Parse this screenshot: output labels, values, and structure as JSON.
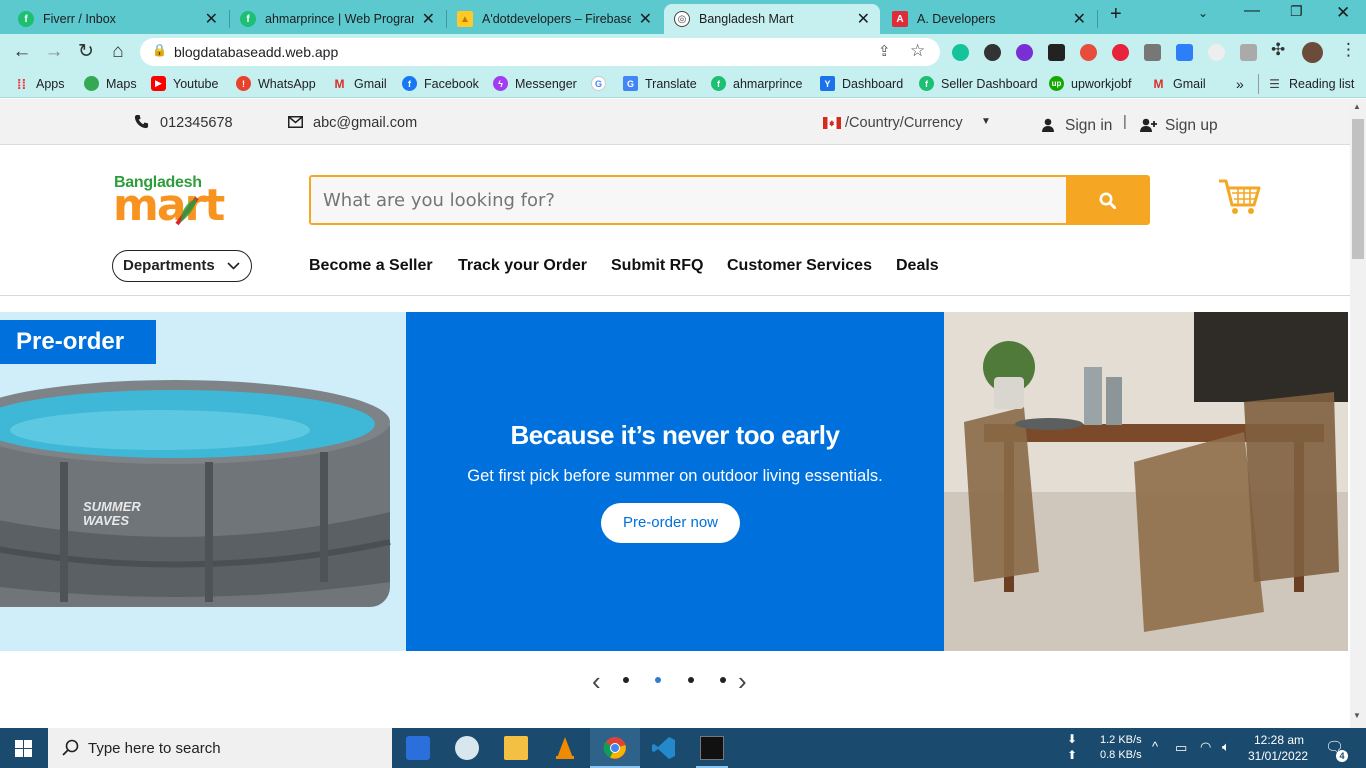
{
  "browser": {
    "tabs": [
      {
        "title": "Fiverr / Inbox",
        "active": false
      },
      {
        "title": "ahmarprince | Web Programm",
        "active": false
      },
      {
        "title": "A'dotdevelopers – Firebase c",
        "active": false
      },
      {
        "title": "Bangladesh Mart",
        "active": true
      },
      {
        "title": "A. Developers",
        "active": false
      }
    ],
    "new_tab": "+",
    "url": "blogdatabaseadd.web.app",
    "bookmarks": [
      "Apps",
      "Maps",
      "Youtube",
      "WhatsApp",
      "Gmail",
      "Facebook",
      "Messenger",
      "",
      "Translate",
      "ahmarprince",
      "Dashboard",
      "Seller Dashboard",
      "upworkjobf",
      "Gmail"
    ],
    "overflow": "»",
    "reading_list": "Reading list"
  },
  "site": {
    "phone": "012345678",
    "email": "abc@gmail.com",
    "country_currency": "/Country/Currency",
    "sign_in": "Sign in",
    "divider": "|",
    "sign_up": "Sign up",
    "logo_line1": "Bangladesh",
    "logo_line2": "mart",
    "search_placeholder": "What are you looking for?",
    "departments": "Departments",
    "nav": [
      "Become a Seller",
      "Track your Order",
      "Submit RFQ",
      "Customer Services",
      "Deals"
    ],
    "banner": {
      "tag": "Pre-order",
      "pool_brand": "SUMMER WAVES",
      "heading": "Because it’s never too early",
      "sub": "Get first pick before summer on outdoor living essentials.",
      "cta": "Pre-order now"
    },
    "carousel": {
      "slides": 4,
      "active_index": 1
    }
  },
  "taskbar": {
    "search_placeholder": "Type here to search",
    "net_down": "1.2 KB/s",
    "net_up": "0.8 KB/s",
    "time": "12:28 am",
    "date": "31/01/2022",
    "notification_count": "4"
  },
  "colors": {
    "tab_strip": "#5cc9cf",
    "toolbar": "#c6eff0",
    "accent_orange": "#f5a623",
    "banner_blue": "#0071dc",
    "taskbar": "#1a4b6e"
  }
}
